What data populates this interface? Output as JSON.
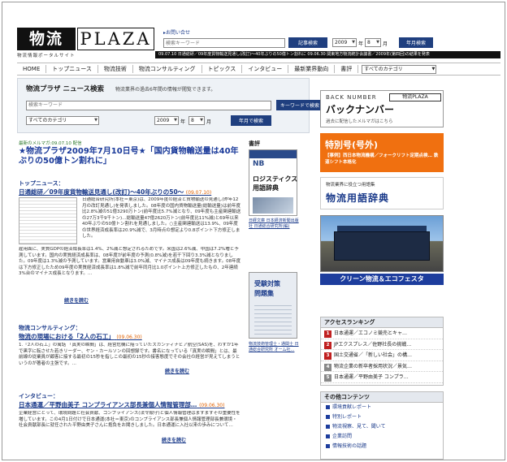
{
  "header": {
    "logo_kanji": "物流",
    "logo_plaza": "PLAZA",
    "logo_sub": "物流情報ポータルサイト",
    "help_link": "お問い合せ",
    "search_placeholder": "検索キーワード",
    "search_button": "記事検索",
    "year": "2009",
    "year_unit": "年",
    "month": "8",
    "month_unit": "月",
    "month_button": "年月検索",
    "ticker": "09.07.10 日通総研／09年度貨物輸送見通し(改訂)～40年ぶりの50億トン割れに    09.06.30 関東地方物流統計会議書／2009年(第四回)の結果を発表"
  },
  "nav": {
    "items": [
      "HOME",
      "トップニュース",
      "物流技術",
      "物流コンサルティング",
      "トピックス",
      "インタビュー",
      "最新業界動向",
      "書評"
    ],
    "category": "すべてのカテゴリ"
  },
  "search_panel": {
    "title": "物流プラザ ニュース検索",
    "desc": "物流業界の過去6年間の情報が閲覧できます。",
    "placeholder": "検索キーワード",
    "search_button": "キーワードで検索",
    "category": "すべてのカテゴリ",
    "year": "2009",
    "year_unit": "年",
    "month": "8",
    "month_unit": "月",
    "month_button": "年月で検索"
  },
  "main": {
    "mail_date": "最新のメルマガ:09.07.10 配信",
    "headline": "★物流プラザ2009年7月10日号★「国内貨物輸送量は40年ぶりの50億トン割れに」",
    "top_news": {
      "label": "トップニュース：",
      "title": "日通総研／09年度貨物輸送見通し(改訂)～40年ぶりの50～",
      "date": "(09.07.10)",
      "body_right": "日通総合研究所(本社＝東京)は、2009年度の経済と貨物輸送の見通し(昨年12月の改訂見通し)を発表しました。08年度の国内貨物輸送量(総輸送量)は前年度比2.8%減の51億3290万トン(前年度比5.7%減となり、09年度も主産関連輸送の27万3千9千トン)…総輸送量47億2620万トン(前年度比11%減)と69年以来40年ぶりの50億トン割れを見通しました。○主産関連輸送は13.9%、09年度の世界経済成長率は20.9%減で、3月時点の想定より0.8ポイント下方修正しました。",
      "body_full": "雇用面に、実質GDPの経済成長率は1.4%、2%減と想定されるためです。米国は2.6%減、中国は7.2%増と予測しています。国内の実質経済成長率は、08年度が前年度の予測(0.8%減)を若干下回り3.3%減となりました。09年度は1.3%減の予測しています。営業用自動車は3.0%減、マイナス成長は09年度も続きます。08年度は下方修正したため09年度の実質経済成長率は1.8%減で前年同月比1.0ポイント上方修正したもの、2年連続3%台のマイナス成長となります。…",
      "more": "続きを読む"
    },
    "consulting": {
      "label": "物流コンサルティング：",
      "title": "物流の現場における「2人の石工」",
      "date": "(09.06.30)",
      "body": "1.「2人の石工」の寓話 「真実の瞬間」は、経営危機に陥っていたスカンディナビア航空(SAS)を、わずか1年で黒字に転させた若きリーダー、ヤン・カールソンの回想録です。書名になっている「真実の瞬間」とは、最前線の従業員が顧客に接する最初の15秒を指しこの最初の15秒の接客態度でその会社の経営が見えてしまうというのが著者の主張です。…",
      "more": "続きを読む"
    },
    "interview": {
      "label": "インタビュー：",
      "title": "日本通運／平野由美子 コンプライアンス部長兼個人情報管理部…",
      "date": "(09.06.30)",
      "body": "企業経営にとって、環境問題と社会貢献、コンプライアンス(法令順守)と個人情報管理はますますその重要性を増しています。この4月1日付けで日本通運(本社＝東京)のコンプライアンス部長兼個人情報管理部長兼環境・社会貢献部長に就任された平野由美子さんに抱負をお聞きしました。日本通運に入社以来の歩みについて…",
      "more": "続きを読む"
    }
  },
  "books": {
    "label": "書評",
    "book1": {
      "band": "NB",
      "title1": "ロジスティクス",
      "title2": "用語辞典",
      "caption": "日経文庫 日本経済新聞出版社 日通総合研究所(編)"
    },
    "book2": {
      "title1": "受験対策",
      "title2": "問題集",
      "caption": "物流技術管理士・通関士 日通総合研究所 オーム社…"
    }
  },
  "side": {
    "backnumber": {
      "en": "BACK NUMBER",
      "tag": "物流PLAZA",
      "title": "バックナンバー",
      "sub": "過去に配信したメルマガはこちら"
    },
    "special": {
      "title": "特別号(号外)",
      "body": "【事例】西日本物流機構／フォークリフト定期点検… 鉄道シフト本格化"
    },
    "dict": {
      "sub": "物流業界に役立つ用語集",
      "title": "物流用語辞典"
    },
    "eco_button": "クリーン物流＆エコフェスタ",
    "ranking": {
      "head": "アクセスランキング",
      "items": [
        {
          "num": "1",
          "text": "日本通運／エコノミ競売とキャ…"
        },
        {
          "num": "2",
          "text": "JPエクスプレス／佐野社長の挑戦…"
        },
        {
          "num": "3",
          "text": "国土交通省／「新しい社会」の構…"
        },
        {
          "num": "4",
          "text": "物流企業の新卒者採用状況／景気…"
        },
        {
          "num": "5",
          "text": "日本通運／平野由美子 コンプラ…"
        }
      ]
    },
    "other": {
      "head": "その他コンテンツ",
      "items": [
        "環境貢献レポート",
        "特別レポート",
        "物流視察、見て、聞いて",
        "企業訪問",
        "情報技術の話題"
      ]
    }
  }
}
